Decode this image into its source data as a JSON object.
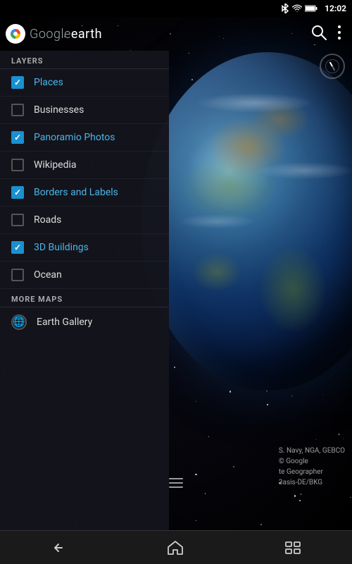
{
  "app": {
    "title": "earth",
    "google_prefix": "Google"
  },
  "status_bar": {
    "time": "12:02",
    "bluetooth_icon": "bluetooth",
    "wifi_icon": "wifi",
    "battery_icon": "battery"
  },
  "toolbar": {
    "search_icon": "search",
    "more_icon": "more-vertical"
  },
  "layers": {
    "section_label": "LAYERS",
    "items": [
      {
        "id": "places",
        "label": "Places",
        "checked": true,
        "active": true
      },
      {
        "id": "businesses",
        "label": "Businesses",
        "checked": false,
        "active": false
      },
      {
        "id": "panoramio",
        "label": "Panoramio Photos",
        "checked": true,
        "active": true
      },
      {
        "id": "wikipedia",
        "label": "Wikipedia",
        "checked": false,
        "active": false
      },
      {
        "id": "borders",
        "label": "Borders and Labels",
        "checked": true,
        "active": true
      },
      {
        "id": "roads",
        "label": "Roads",
        "checked": false,
        "active": false
      },
      {
        "id": "buildings",
        "label": "3D Buildings",
        "checked": true,
        "active": true
      },
      {
        "id": "ocean",
        "label": "Ocean",
        "checked": false,
        "active": false
      }
    ]
  },
  "more_maps": {
    "section_label": "MORE MAPS",
    "items": [
      {
        "id": "earth-gallery",
        "label": "Earth Gallery"
      }
    ]
  },
  "attribution": {
    "lines": [
      "S. Navy, NGA, GEBCO",
      "© Google",
      "te Geographer",
      "3asis-DE/BKG"
    ]
  },
  "earth_label": "Earth",
  "nav": {
    "back_icon": "←",
    "home_icon": "⌂",
    "recents_icon": "▭"
  },
  "compass": {
    "visible": true
  }
}
